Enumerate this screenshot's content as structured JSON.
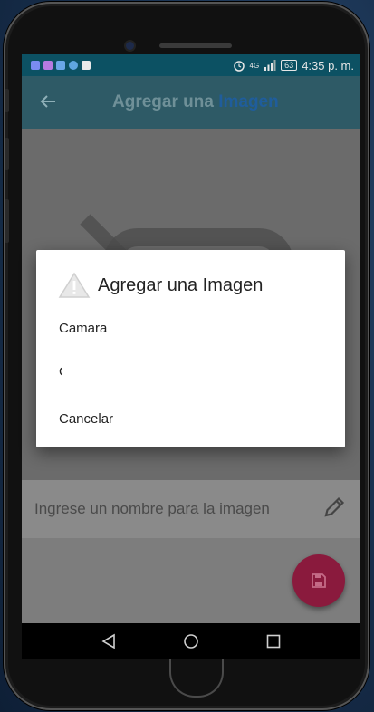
{
  "status_bar": {
    "network": "4G",
    "battery": "63",
    "time": "4:35 p. m."
  },
  "app_bar": {
    "title_part1": "Agregar una",
    "title_part2": "Imagen"
  },
  "form": {
    "name_placeholder": "Ingrese un nombre para la imagen"
  },
  "dialog": {
    "title": "Agregar una Imagen",
    "options": [
      "Camara",
      "G",
      "Cancelar"
    ]
  },
  "colors": {
    "status_bar": "#0c5163",
    "app_bar": "#2e5a66",
    "fab": "#8a1a3d",
    "dialog_bg": "#ffffff"
  },
  "icons": {
    "back": "arrow-left-icon",
    "edit": "pencil-icon",
    "save": "floppy-disk-icon",
    "warning": "warning-triangle-icon",
    "alarm": "alarm-clock-icon",
    "signal": "signal-icon",
    "battery": "battery-icon"
  }
}
